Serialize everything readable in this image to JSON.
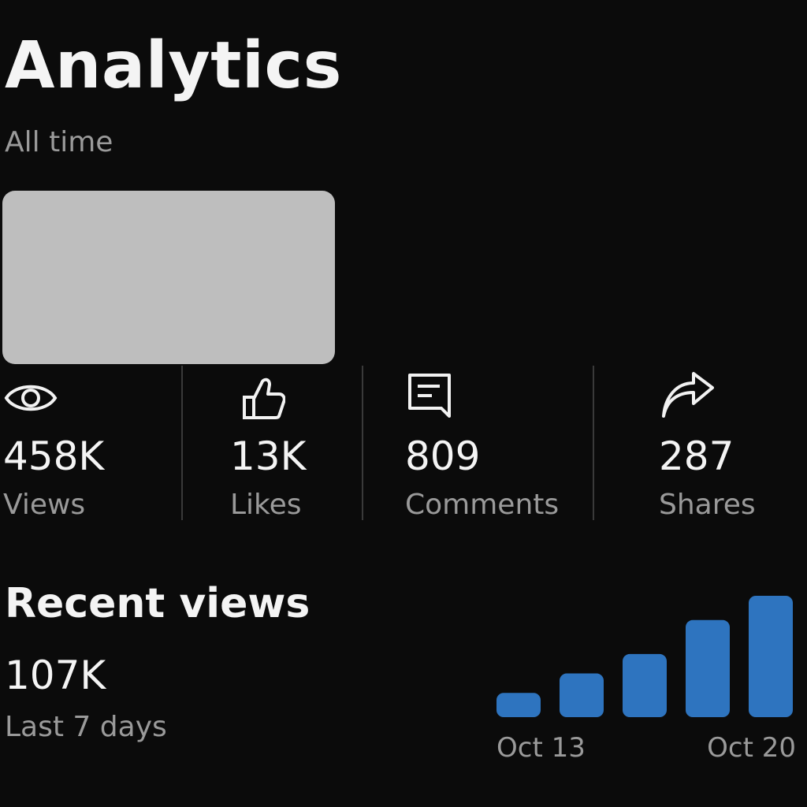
{
  "header": {
    "title": "Analytics",
    "subtitle": "All time"
  },
  "stats": [
    {
      "icon": "eye-icon",
      "value": "458K",
      "label": "Views"
    },
    {
      "icon": "thumbs-up-icon",
      "value": "13K",
      "label": "Likes"
    },
    {
      "icon": "comment-icon",
      "value": "809",
      "label": "Comments"
    },
    {
      "icon": "share-arrow-icon",
      "value": "287",
      "label": "Shares"
    }
  ],
  "recent": {
    "title": "Recent views",
    "value": "107K",
    "period": "Last 7 days"
  },
  "colors": {
    "accent": "#2e74bf",
    "background": "#0b0b0b",
    "muted_text": "#9a9a9a"
  },
  "chart_data": {
    "type": "bar",
    "tick_labels": [
      "Oct 13",
      "Oct 20"
    ],
    "values": [
      1,
      1.8,
      2.6,
      4.0,
      5.0
    ],
    "title": "",
    "xlabel": "",
    "ylabel": ""
  }
}
